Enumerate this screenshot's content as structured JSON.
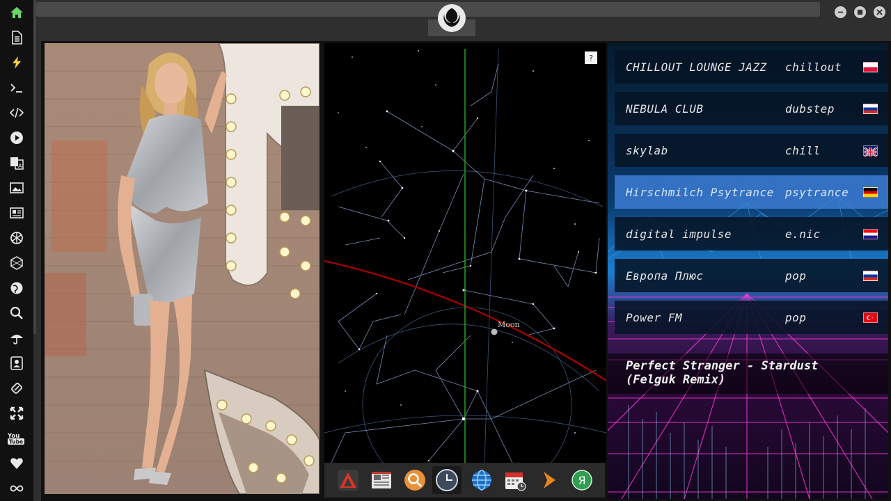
{
  "sidebar": {
    "items": [
      {
        "icon": "home-icon",
        "color": "#6bd36b"
      },
      {
        "icon": "document-icon"
      },
      {
        "icon": "lightning-icon",
        "color": "#f5d142"
      },
      {
        "icon": "terminal-icon"
      },
      {
        "icon": "code-icon"
      },
      {
        "icon": "play-icon"
      },
      {
        "icon": "translate-icon"
      },
      {
        "icon": "image-icon"
      },
      {
        "icon": "news-icon"
      },
      {
        "icon": "rebel-icon"
      },
      {
        "icon": "hexagon-icon"
      },
      {
        "icon": "globe-icon"
      },
      {
        "icon": "search-icon"
      },
      {
        "icon": "umbrella-icon"
      },
      {
        "icon": "contact-icon"
      },
      {
        "icon": "link-icon"
      },
      {
        "icon": "expand-icon"
      },
      {
        "icon": "youtube-icon",
        "label": "You Tube"
      },
      {
        "icon": "heart-icon"
      },
      {
        "icon": "infinity-icon"
      }
    ]
  },
  "sky": {
    "help_label": "?",
    "moon_label": "Moon"
  },
  "radio": {
    "stations": [
      {
        "name": "CHILLOUT LOUNGE JAZZ",
        "genre": "chillout",
        "flag": "pl"
      },
      {
        "name": "NEBULA CLUB",
        "genre": "dubstep",
        "flag": "ru"
      },
      {
        "name": "skylab",
        "genre": "chill",
        "flag": "gb"
      },
      {
        "name": "Hirschmilch Psytrance",
        "genre": "psytrance",
        "flag": "de",
        "selected": true
      },
      {
        "name": "digital impulse",
        "genre": "e.nic",
        "flag": "hr"
      },
      {
        "name": "Европа Плюс",
        "genre": "pop",
        "flag": "ru"
      },
      {
        "name": "Power FM",
        "genre": "pop",
        "flag": "tr"
      }
    ],
    "now_playing": "Perfect Stranger - Stardust (Felguk Remix)"
  },
  "dock": {
    "apps": [
      "aurora-app-icon",
      "news-app-icon",
      "search-app-icon",
      "clock-app-icon",
      "globe-app-icon",
      "calendar-app-icon",
      "play-app-icon",
      "yandex-app-icon"
    ],
    "yandex_letter": "Я"
  },
  "colors": {
    "accent_green": "#6bd36b",
    "selected_station": "#4082dc",
    "ecliptic": "#a00000",
    "meridian": "#1f9a1f"
  }
}
